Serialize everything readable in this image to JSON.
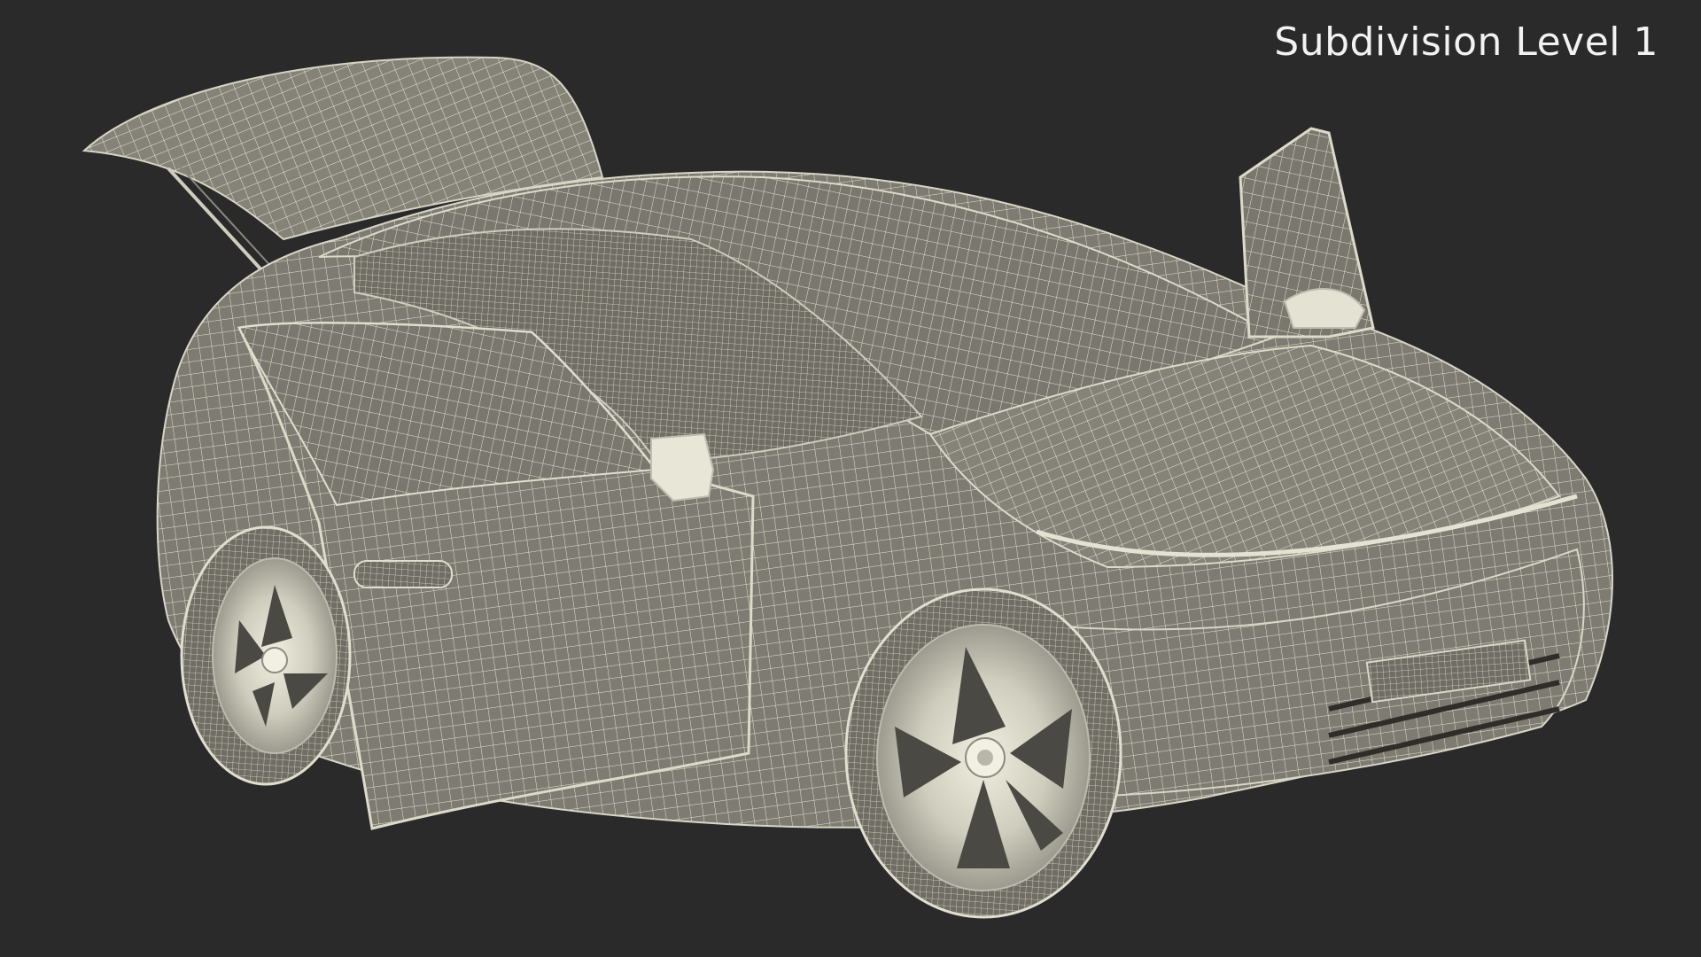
{
  "overlay": {
    "label": "Subdivision Level 1"
  },
  "scene": {
    "subject": "car-wireframe-render",
    "background_color": "#2a2a2a",
    "body_color": "#7e7c72",
    "wire_color": "#e8e6d6",
    "wheel_color": "#d8d6c4"
  }
}
